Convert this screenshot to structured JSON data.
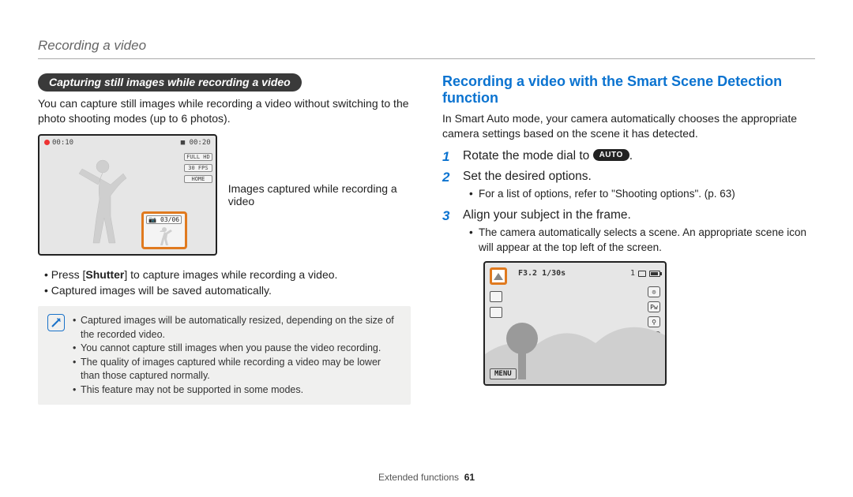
{
  "breadcrumb": "Recording a video",
  "left": {
    "pill": "Capturing still images while recording a video",
    "intro": "You can capture still images while recording a video without switching to the photo shooting modes (up to 6 photos).",
    "lcd": {
      "rec_time": "00:10",
      "remain_time": "00:20",
      "side": [
        "FULL\nHD",
        "30\nFPS",
        "HOME"
      ],
      "thumb_counter": "03/06"
    },
    "figure_caption": "Images captured while recording a video",
    "bullets_prefix": "Press [",
    "bullets_bold": "Shutter",
    "bullets_suffix": "] to capture images while recording a video.",
    "bullet2": "Captured images will be saved automatically.",
    "notes": [
      "Captured images will be automatically resized, depending on the size of the recorded video.",
      "You cannot capture still images when you pause the video recording.",
      "The quality of images captured while recording a video may be lower than those captured normally.",
      "This feature may not be supported in some modes."
    ]
  },
  "right": {
    "heading": "Recording a video with the Smart Scene Detection function",
    "intro": "In Smart Auto mode, your camera automatically chooses the appropriate camera settings based on the scene it has detected.",
    "step1_pre": "Rotate the mode dial to ",
    "auto_badge": "AUTO",
    "step1_post": ".",
    "step2": "Set the desired options.",
    "step2_sub": "For a list of options, refer to \"Shooting options\". (p. 63)",
    "step3": "Align your subject in the frame.",
    "step3_sub": "The camera automatically selects a scene. An appropriate scene icon will appear at the top left of the screen.",
    "lcd2": {
      "exposure": "F3.2  1/30s",
      "counter": "1",
      "menu": "MENU"
    }
  },
  "footer": {
    "section": "Extended functions",
    "page": "61"
  }
}
